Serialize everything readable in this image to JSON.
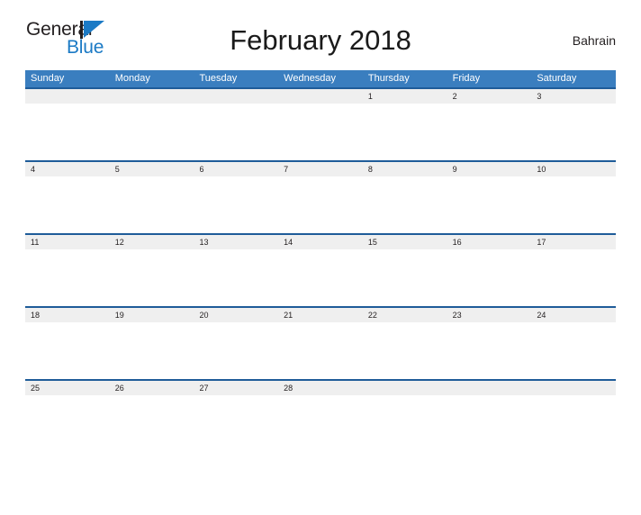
{
  "logo": {
    "primary_text": "General",
    "secondary_text": "Blue",
    "mark_icon": "blue-pennant-flag-icon",
    "primary_color": "#231f20",
    "secondary_color": "#1b7ac5"
  },
  "header": {
    "title": "February 2018",
    "country": "Bahrain"
  },
  "calendar": {
    "month": "February",
    "year": "2018",
    "header_bg_color": "#3a7ebf",
    "week_border_color": "#1f5c99",
    "date_band_color": "#efefef",
    "weekdays": [
      "Sunday",
      "Monday",
      "Tuesday",
      "Wednesday",
      "Thursday",
      "Friday",
      "Saturday"
    ],
    "weeks": [
      [
        "",
        "",
        "",
        "",
        "1",
        "2",
        "3"
      ],
      [
        "4",
        "5",
        "6",
        "7",
        "8",
        "9",
        "10"
      ],
      [
        "11",
        "12",
        "13",
        "14",
        "15",
        "16",
        "17"
      ],
      [
        "18",
        "19",
        "20",
        "21",
        "22",
        "23",
        "24"
      ],
      [
        "25",
        "26",
        "27",
        "28",
        "",
        "",
        ""
      ]
    ]
  }
}
